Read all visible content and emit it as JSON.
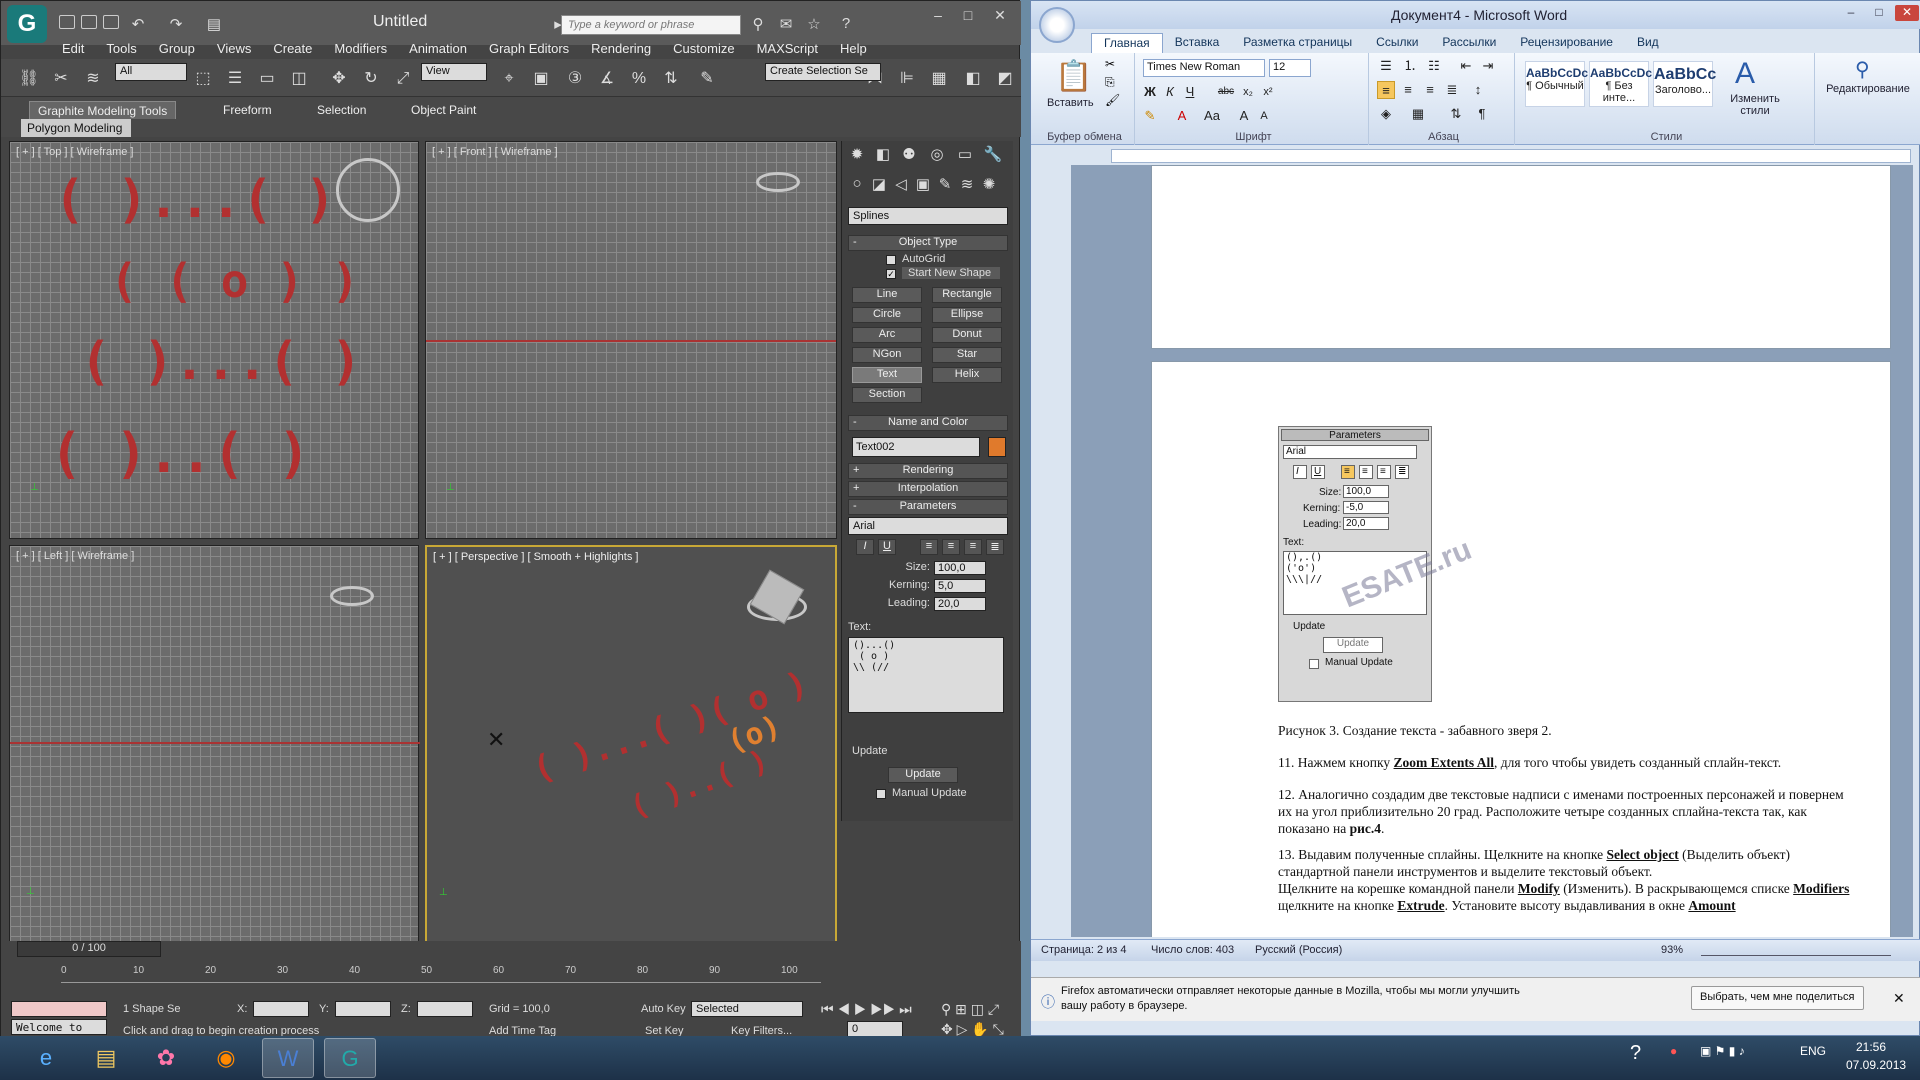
{
  "max": {
    "title": "Untitled",
    "search_placeholder": "Type a keyword or phrase",
    "menu": [
      "Edit",
      "Tools",
      "Group",
      "Views",
      "Create",
      "Modifiers",
      "Animation",
      "Graph Editors",
      "Rendering",
      "Customize",
      "MAXScript",
      "Help"
    ],
    "toolbar": {
      "filter": "All",
      "view": "View",
      "selection_set": "Create Selection Se"
    },
    "ribbon_tabs": [
      "Graphite Modeling Tools",
      "Freeform",
      "Selection",
      "Object Paint"
    ],
    "polygon_modeling": "Polygon Modeling",
    "viewports": {
      "top": "[ + ] [ Top ] [ Wireframe ]",
      "front": "[ + ] [ Front ] [ Wireframe ]",
      "left": "[ + ] [ Left ] [ Wireframe ]",
      "persp": "[ + ] [ Perspective ] [ Smooth + Highlights ]"
    },
    "cmd": {
      "category": "Splines",
      "object_type": "Object Type",
      "autogrid": "AutoGrid",
      "start_new_shape": "Start New Shape",
      "buttons": [
        "Line",
        "Rectangle",
        "Circle",
        "Ellipse",
        "Arc",
        "Donut",
        "NGon",
        "Star",
        "Text",
        "Helix",
        "Section"
      ],
      "name_and_color": "Name and Color",
      "name": "Text002",
      "rendering": "Rendering",
      "interpolation": "Interpolation",
      "parameters": "Parameters",
      "font": "Arial",
      "fmt": [
        "I",
        "U"
      ],
      "size_label": "Size:",
      "size": "100,0",
      "kerning_label": "Kerning:",
      "kerning": "5,0",
      "leading_label": "Leading:",
      "leading": "20,0",
      "text_label": "Text:",
      "text": "()...()\n ( o )\n\\\\ (//",
      "update_group": "Update",
      "update_btn": "Update",
      "manual_update": "Manual Update",
      "swatch_color": "#e07a2c"
    },
    "timeline": "0 / 100",
    "ticks": [
      "0",
      "10",
      "20",
      "30",
      "40",
      "50",
      "60",
      "70",
      "80",
      "90",
      "100"
    ],
    "status": {
      "welcome": "Welcome to M:",
      "selection": "1 Shape Se",
      "x_label": "X:",
      "y_label": "Y:",
      "z_label": "Z:",
      "grid": "Grid = 100,0",
      "auto_key": "Auto Key",
      "selected": "Selected",
      "set_key": "Set Key",
      "key_filters": "Key Filters...",
      "frame": "0",
      "prompt": "Click and drag to begin creation process",
      "add_time_tag": "Add Time Tag"
    }
  },
  "word": {
    "title": "Документ4 - Microsoft Word",
    "tabs": [
      "Главная",
      "Вставка",
      "Разметка страницы",
      "Ссылки",
      "Рассылки",
      "Рецензирование",
      "Вид"
    ],
    "groups": {
      "clipboard": "Буфер обмена",
      "font": "Шрифт",
      "paragraph": "Абзац",
      "styles": "Стили"
    },
    "paste": "Вставить",
    "font_name": "Times New Roman",
    "font_size": "12",
    "styles": [
      {
        "sample": "AaBbCcDc",
        "name": "¶ Обычный"
      },
      {
        "sample": "AaBbCcDc",
        "name": "¶ Без инте..."
      },
      {
        "sample": "AaBbCc",
        "name": "Заголово..."
      }
    ],
    "change_styles": "Изменить стили",
    "editing": "Редактирование",
    "embed": {
      "header": "Parameters",
      "font": "Arial",
      "size_label": "Size:",
      "size": "100,0",
      "kerning_label": "Kerning:",
      "kerning": "-5,0",
      "leading_label": "Leading:",
      "leading": "20,0",
      "text_label": "Text:",
      "text": "(),.()\n('o')\n\\\\\\|//",
      "update_group": "Update",
      "update_btn": "Update",
      "manual_update": "Manual Update",
      "watermark": "ESATE.ru"
    },
    "caption": "Рисунок 3. Создание текста - забавного зверя 2.",
    "p11_a": "11. Нажмем кнопку ",
    "p11_b": "Zoom Extents All",
    "p11_c": ", для того чтобы увидеть созданный сплайн-текст.",
    "p12_a": "12. Аналогично создадим две текстовые надписи с именами построенных персонажей и повернем их на угол приблизительно 20 град. Расположите четыре созданных сплайна-текста так, как показано на ",
    "p12_b": "рис.4",
    "p12_c": ".",
    "p13_a": "13. Выдавим полученные сплайны. Щелкните на кнопке ",
    "p13_b": "Select object",
    "p13_c": " (Выделить объект) стандартной панели инструментов и выделите текстовый объект.",
    "p13_d": "Щелкните на корешке командной панели ",
    "p13_e": "Modify",
    "p13_f": " (Изменить). В раскрывающемся списке ",
    "p13_g": "Modifiers",
    "p13_h": " щелкните на кнопке ",
    "p13_i": "Extrude",
    "p13_j": ". Установите высоту выдавливания в окне ",
    "p13_k": "Amount",
    "status": {
      "page": "Страница: 2 из 4",
      "words": "Число слов: 403",
      "lang": "Русский (Россия)",
      "zoom": "93%"
    },
    "notification": "Firefox автоматически отправляет некоторые данные в Mozilla, чтобы мы могли улучшить вашу работу в браузере.",
    "share_btn": "Выбрать, чем мне поделиться"
  },
  "taskbar": {
    "lang": "ENG",
    "time": "21:56",
    "date": "07.09.2013"
  }
}
